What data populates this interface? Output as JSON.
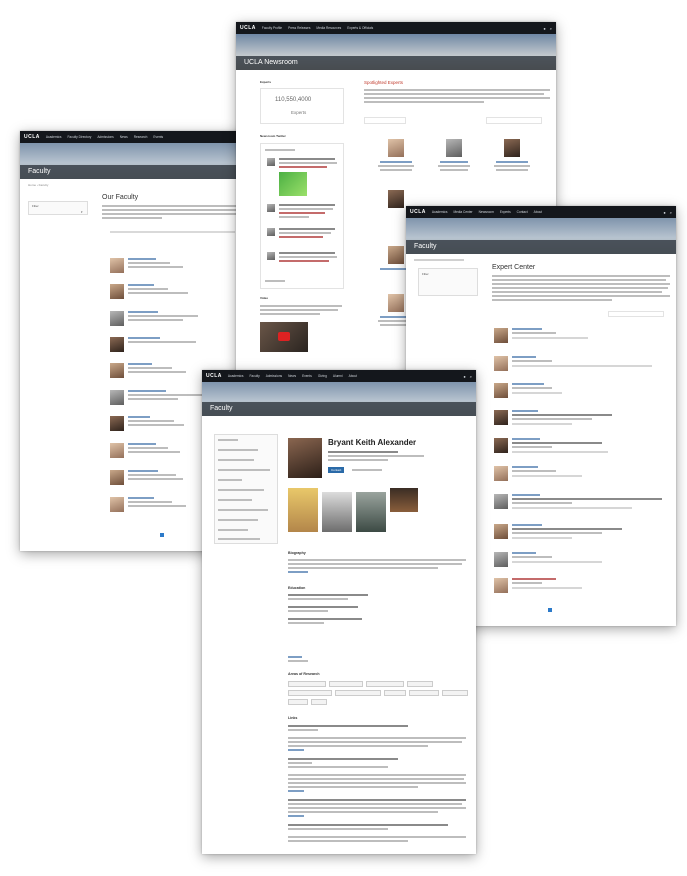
{
  "pages": {
    "faculty_list": {
      "logo": "UCLA",
      "nav": [
        "Academics",
        "Faculty Directory",
        "Admissions",
        "News",
        "Research",
        "Events"
      ],
      "banner_title": "Faculty",
      "breadcrumb": "Home › Faculty",
      "heading": "Our Faculty",
      "filter_label": "Filter"
    },
    "newsroom": {
      "logo": "UCLA",
      "nav": [
        "Faculty Profile",
        "Press Releases",
        "Media Resources",
        "Experts & Officials"
      ],
      "banner_title": "UCLA Newsroom",
      "sidebar_heading": "Experts",
      "counter_value": "110,550,4000",
      "counter_label": "Experts",
      "section_heading": "Spotlighted Experts",
      "social_heading": "Newsroom Twitter",
      "video_heading": "Video"
    },
    "expert_center": {
      "logo": "UCLA",
      "nav": [
        "Academics",
        "Media Center",
        "Newsroom",
        "Experts",
        "Contact",
        "About"
      ],
      "banner_title": "Faculty",
      "heading": "Expert Center",
      "filter_label": "Filter"
    },
    "profile": {
      "logo": "UCLA",
      "nav": [
        "Academics",
        "Faculty",
        "Admissions",
        "News",
        "Events",
        "Giving",
        "Alumni",
        "About"
      ],
      "banner_title": "Faculty",
      "name": "Bryant Keith Alexander",
      "contact_button": "Contact",
      "section_biography": "Biography",
      "section_education": "Education",
      "section_areas": "Areas of Research",
      "section_links": "Links"
    }
  },
  "colors": {
    "nav": "#14171c",
    "banner_bar": "#373e46",
    "accent": "#2c7ac9"
  }
}
